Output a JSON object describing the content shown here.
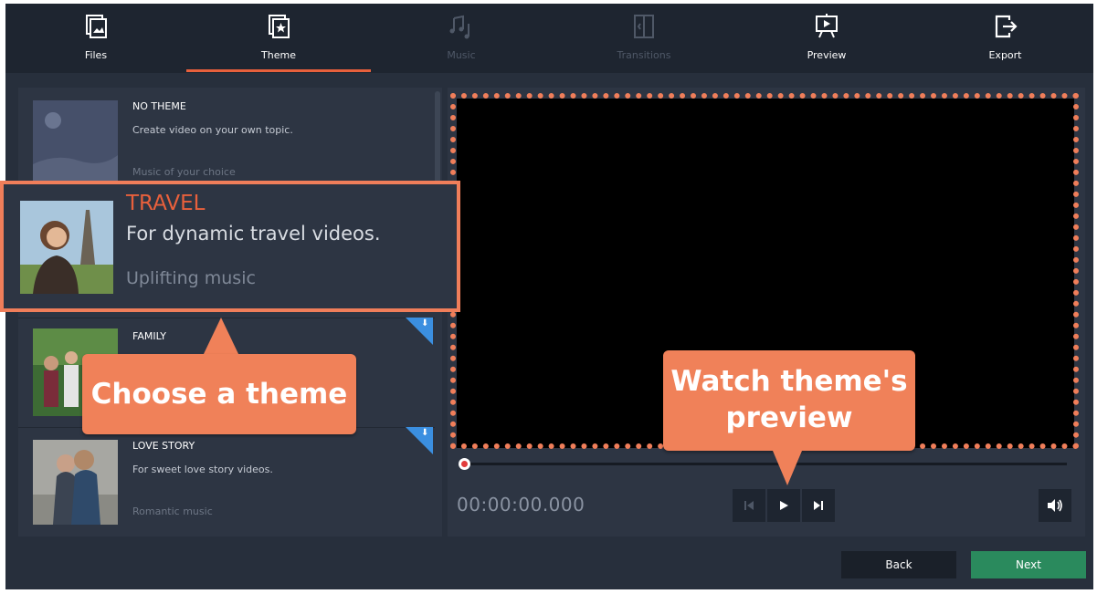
{
  "tabs": [
    {
      "label": "Files",
      "icon": "files-icon",
      "active": false,
      "enabled": true
    },
    {
      "label": "Theme",
      "icon": "theme-icon",
      "active": true,
      "enabled": true
    },
    {
      "label": "Music",
      "icon": "music-icon",
      "active": false,
      "enabled": false
    },
    {
      "label": "Transitions",
      "icon": "transitions-icon",
      "active": false,
      "enabled": false
    },
    {
      "label": "Preview",
      "icon": "preview-icon",
      "active": false,
      "enabled": true
    },
    {
      "label": "Export",
      "icon": "export-icon",
      "active": false,
      "enabled": true
    }
  ],
  "themes": [
    {
      "name": "NO THEME",
      "description": "Create video on your own topic.",
      "music": "Music of your choice",
      "downloadable": false
    },
    {
      "name": "TRAVEL",
      "description": "For dynamic travel videos.",
      "music": "Uplifting music",
      "downloadable": false,
      "selected": true
    },
    {
      "name": "FAMILY",
      "description": "",
      "music": "",
      "downloadable": true
    },
    {
      "name": "LOVE STORY",
      "description": "For sweet love story videos.",
      "music": "Romantic music",
      "downloadable": true
    }
  ],
  "player": {
    "timecode": "00:00:00.000",
    "position": 0
  },
  "buttons": {
    "back": "Back",
    "next": "Next"
  },
  "callouts": {
    "choose_theme": "Choose a theme",
    "watch_line1": "Watch theme's",
    "watch_line2": "preview"
  },
  "colors": {
    "accent": "#e8603c",
    "callout": "#f08159",
    "next_button": "#2a8a5d",
    "background": "#272f3c"
  }
}
